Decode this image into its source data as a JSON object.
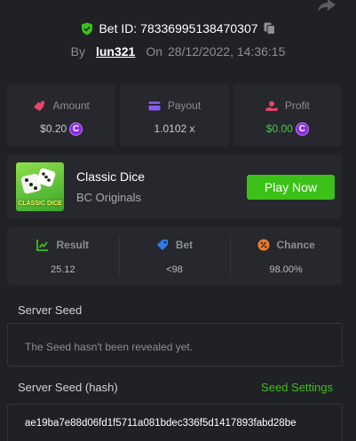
{
  "header": {
    "bet_id_label": "Bet ID:",
    "bet_id": "78336995138470307",
    "by_label": "By",
    "user": "lun321",
    "on_label": "On",
    "datetime": "28/12/2022, 14:36:15"
  },
  "stats": {
    "amount_label": "Amount",
    "amount_value": "$0.20",
    "payout_label": "Payout",
    "payout_value": "1.0102 x",
    "profit_label": "Profit",
    "profit_value": "$0.00",
    "coin_symbol": "C"
  },
  "game": {
    "thumb_label": "CLASSIC DICE",
    "name": "Classic Dice",
    "provider": "BC Originals",
    "play_label": "Play Now"
  },
  "result": {
    "result_label": "Result",
    "result_value": "25.12",
    "bet_label": "Bet",
    "bet_value": "<98",
    "chance_label": "Chance",
    "chance_value": "98.00%"
  },
  "seed": {
    "server_seed_label": "Server Seed",
    "server_seed_value": "The Seed hasn't been revealed yet.",
    "hash_label": "Server Seed (hash)",
    "settings_label": "Seed Settings",
    "hash_value": "ae19ba7e88d06fd1f5711a081bdec336f5d1417893fabd28be"
  },
  "colors": {
    "accent_green": "#3bc117",
    "profit_green": "#3ccf3c",
    "coin_purple": "#8a2be2",
    "panel": "#26282d",
    "background": "#1f2125"
  }
}
